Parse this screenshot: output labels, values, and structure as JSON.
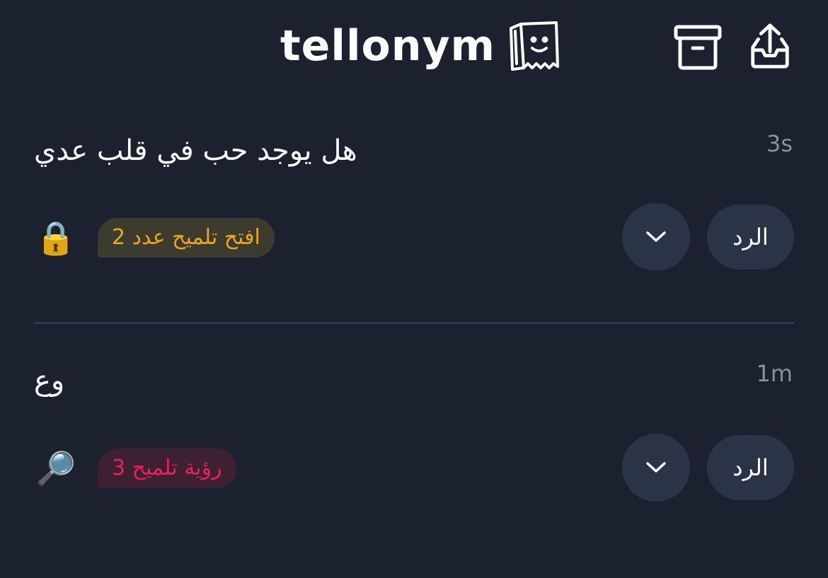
{
  "header": {
    "logo_text": "tellonym",
    "logo_icon": "tellonym-face-icon",
    "archive_icon": "archive-icon",
    "share_icon": "share-icon"
  },
  "tells": [
    {
      "time": "3s",
      "question": "هل يوجد حب في قلب عدي",
      "hint_emoji": "🔒",
      "hint_label": "افتح تلميح عدد 2",
      "hint_color": "#f0a224",
      "reply_label": "الرد",
      "more_icon": "chevron-down-icon"
    },
    {
      "time": "1m",
      "question": "وع",
      "hint_emoji": "🔎",
      "hint_label": "رؤية تلميح 3",
      "hint_color": "#ec1e63",
      "reply_label": "الرد",
      "more_icon": "chevron-down-icon"
    }
  ],
  "colors": {
    "background": "#1c2130",
    "button_bg": "#2b3446",
    "divider": "#2e3a4d",
    "timestamp": "#8a909e"
  }
}
